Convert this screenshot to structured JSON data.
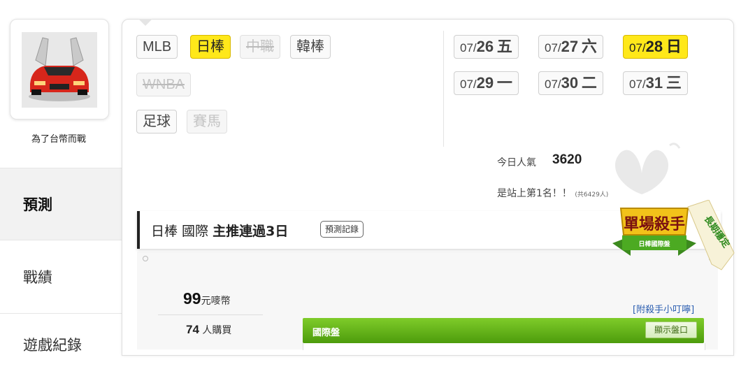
{
  "profile": {
    "username": "為了台幣而戰",
    "avatar_icon": "red-sports-car-icon"
  },
  "side_tabs": {
    "predict": "預測",
    "record": "戰績",
    "game_log": "遊戲紀錄"
  },
  "sports": {
    "mlb": "MLB",
    "npb": "日棒",
    "cpbl": "中職",
    "kbo": "韓棒",
    "wnba": "WNBA",
    "soccer": "足球",
    "horse": "賽馬"
  },
  "dates": [
    {
      "prefix": "07/",
      "day": "26",
      "weekday": "五"
    },
    {
      "prefix": "07/",
      "day": "27",
      "weekday": "六"
    },
    {
      "prefix": "07/",
      "day": "28",
      "weekday": "日"
    },
    {
      "prefix": "07/",
      "day": "29",
      "weekday": "一"
    },
    {
      "prefix": "07/",
      "day": "30",
      "weekday": "二"
    },
    {
      "prefix": "07/",
      "day": "31",
      "weekday": "三"
    }
  ],
  "popularity": {
    "label": "今日人氣",
    "value": "3620",
    "rank_text": "是站上第1名！！",
    "total": "(共6429人)"
  },
  "prediction": {
    "league": "日棒 國際",
    "streak": "主推連過3日",
    "record_button": "預測記錄"
  },
  "badge": {
    "title": "單場殺手",
    "subtitle": "日棒國際盤",
    "ribbon": "長期穩定"
  },
  "purchase": {
    "price": "99",
    "price_unit": "元嘜幣",
    "buyers": "74",
    "buyers_unit": "人購買",
    "tips_link": "[附殺手小叮嚀]"
  },
  "market": {
    "label": "國際盤",
    "show_button": "顯示盤口"
  },
  "colors": {
    "active_yellow": "#ffe81a",
    "market_green": "#5aaa14",
    "badge_gold": "#e0a500"
  }
}
